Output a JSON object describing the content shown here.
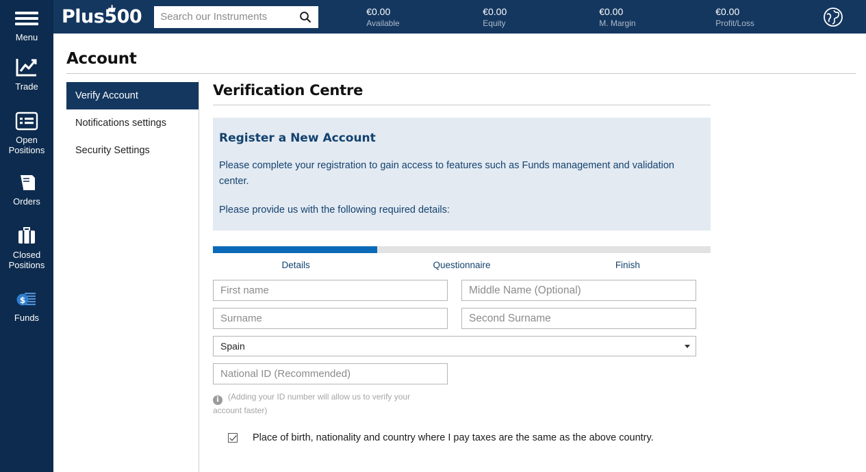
{
  "rail": {
    "items": [
      {
        "label": "Menu",
        "icon": "hamburger-menu-icon"
      },
      {
        "label": "Trade",
        "icon": "chart-line-icon"
      },
      {
        "label": "Open\nPositions",
        "label_line1": "Open",
        "label_line2": "Positions",
        "icon": "list-icon"
      },
      {
        "label": "Orders",
        "icon": "book-icon"
      },
      {
        "label": "Closed\nPositions",
        "label_line1": "Closed",
        "label_line2": "Positions",
        "icon": "briefcase-icon"
      },
      {
        "label": "Funds",
        "icon": "money-coin-icon"
      }
    ]
  },
  "topbar": {
    "logo": "Plus500",
    "logo_plus": "+",
    "search_placeholder": "Search our Instruments",
    "search_value": "",
    "search_icon": "search-icon",
    "globe_icon": "globe-icon",
    "stats": [
      {
        "value": "€0.00",
        "caption": "Available"
      },
      {
        "value": "€0.00",
        "caption": "Equity"
      },
      {
        "value": "€0.00",
        "caption": "M. Margin"
      },
      {
        "value": "€0.00",
        "caption": "Profit/Loss"
      }
    ]
  },
  "page": {
    "title": "Account"
  },
  "subnav": {
    "items": [
      {
        "label": "Verify Account",
        "active": true
      },
      {
        "label": "Notifications settings",
        "active": false
      },
      {
        "label": "Security Settings",
        "active": false
      }
    ]
  },
  "main": {
    "section_title": "Verification Centre",
    "infobox": {
      "heading": "Register a New Account",
      "paragraph1": "Please complete your registration to gain access to features such as Funds management and validation center.",
      "paragraph2": "Please provide us with the following required details:"
    },
    "progress": {
      "percent": 33,
      "steps": [
        {
          "label": "Details"
        },
        {
          "label": "Questionnaire"
        },
        {
          "label": "Finish"
        }
      ]
    },
    "form": {
      "first_name": {
        "placeholder": "First name",
        "value": ""
      },
      "middle_name": {
        "placeholder": "Middle Name (Optional)",
        "value": ""
      },
      "surname": {
        "placeholder": "Surname",
        "value": ""
      },
      "second_surname": {
        "placeholder": "Second Surname",
        "value": ""
      },
      "country": {
        "selected": "Spain"
      },
      "national_id": {
        "placeholder": "National ID (Recommended)",
        "value": ""
      },
      "hint": "(Adding your ID number will allow us to verify your account faster)",
      "hint_icon": "info-icon",
      "checkbox": {
        "checked": true,
        "label": "Place of birth, nationality and country where I pay taxes are the same as the above country."
      }
    }
  },
  "colors": {
    "rail_bg": "#0d2b4e",
    "topbar_bg": "#14375f",
    "accent_blue": "#0b6ab8",
    "infobox_bg": "#e3eaf2",
    "info_text": "#14426e"
  }
}
